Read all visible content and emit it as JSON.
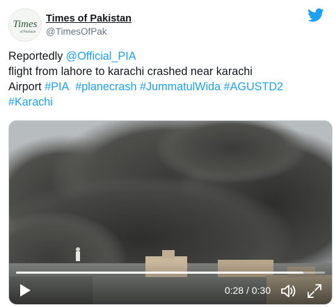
{
  "account": {
    "display_name": "Times of Pakistan",
    "handle": "@TimesOfPak",
    "logo_text": "Times",
    "logo_subtext": "of Pakistan"
  },
  "tweet": {
    "t1": "Reportedly ",
    "mention": "@Official_PIA",
    "t2": " flight from lahore to karachi crashed near karachi",
    "t3": "Airport ",
    "tags": [
      "#PIA",
      "#planecrash",
      "#JummatulWida",
      "#AGUSTD2",
      "#Karachi"
    ]
  },
  "video": {
    "time_display": "0:28 / 0:30",
    "progress_fraction": 0.93
  },
  "icons": {
    "brand": "twitter-bird-icon",
    "play": "play-icon",
    "volume": "volume-icon",
    "fullscreen": "fullscreen-icon"
  },
  "colors": {
    "link": "#1da1f2",
    "handle": "#657786",
    "text": "#14171a"
  }
}
